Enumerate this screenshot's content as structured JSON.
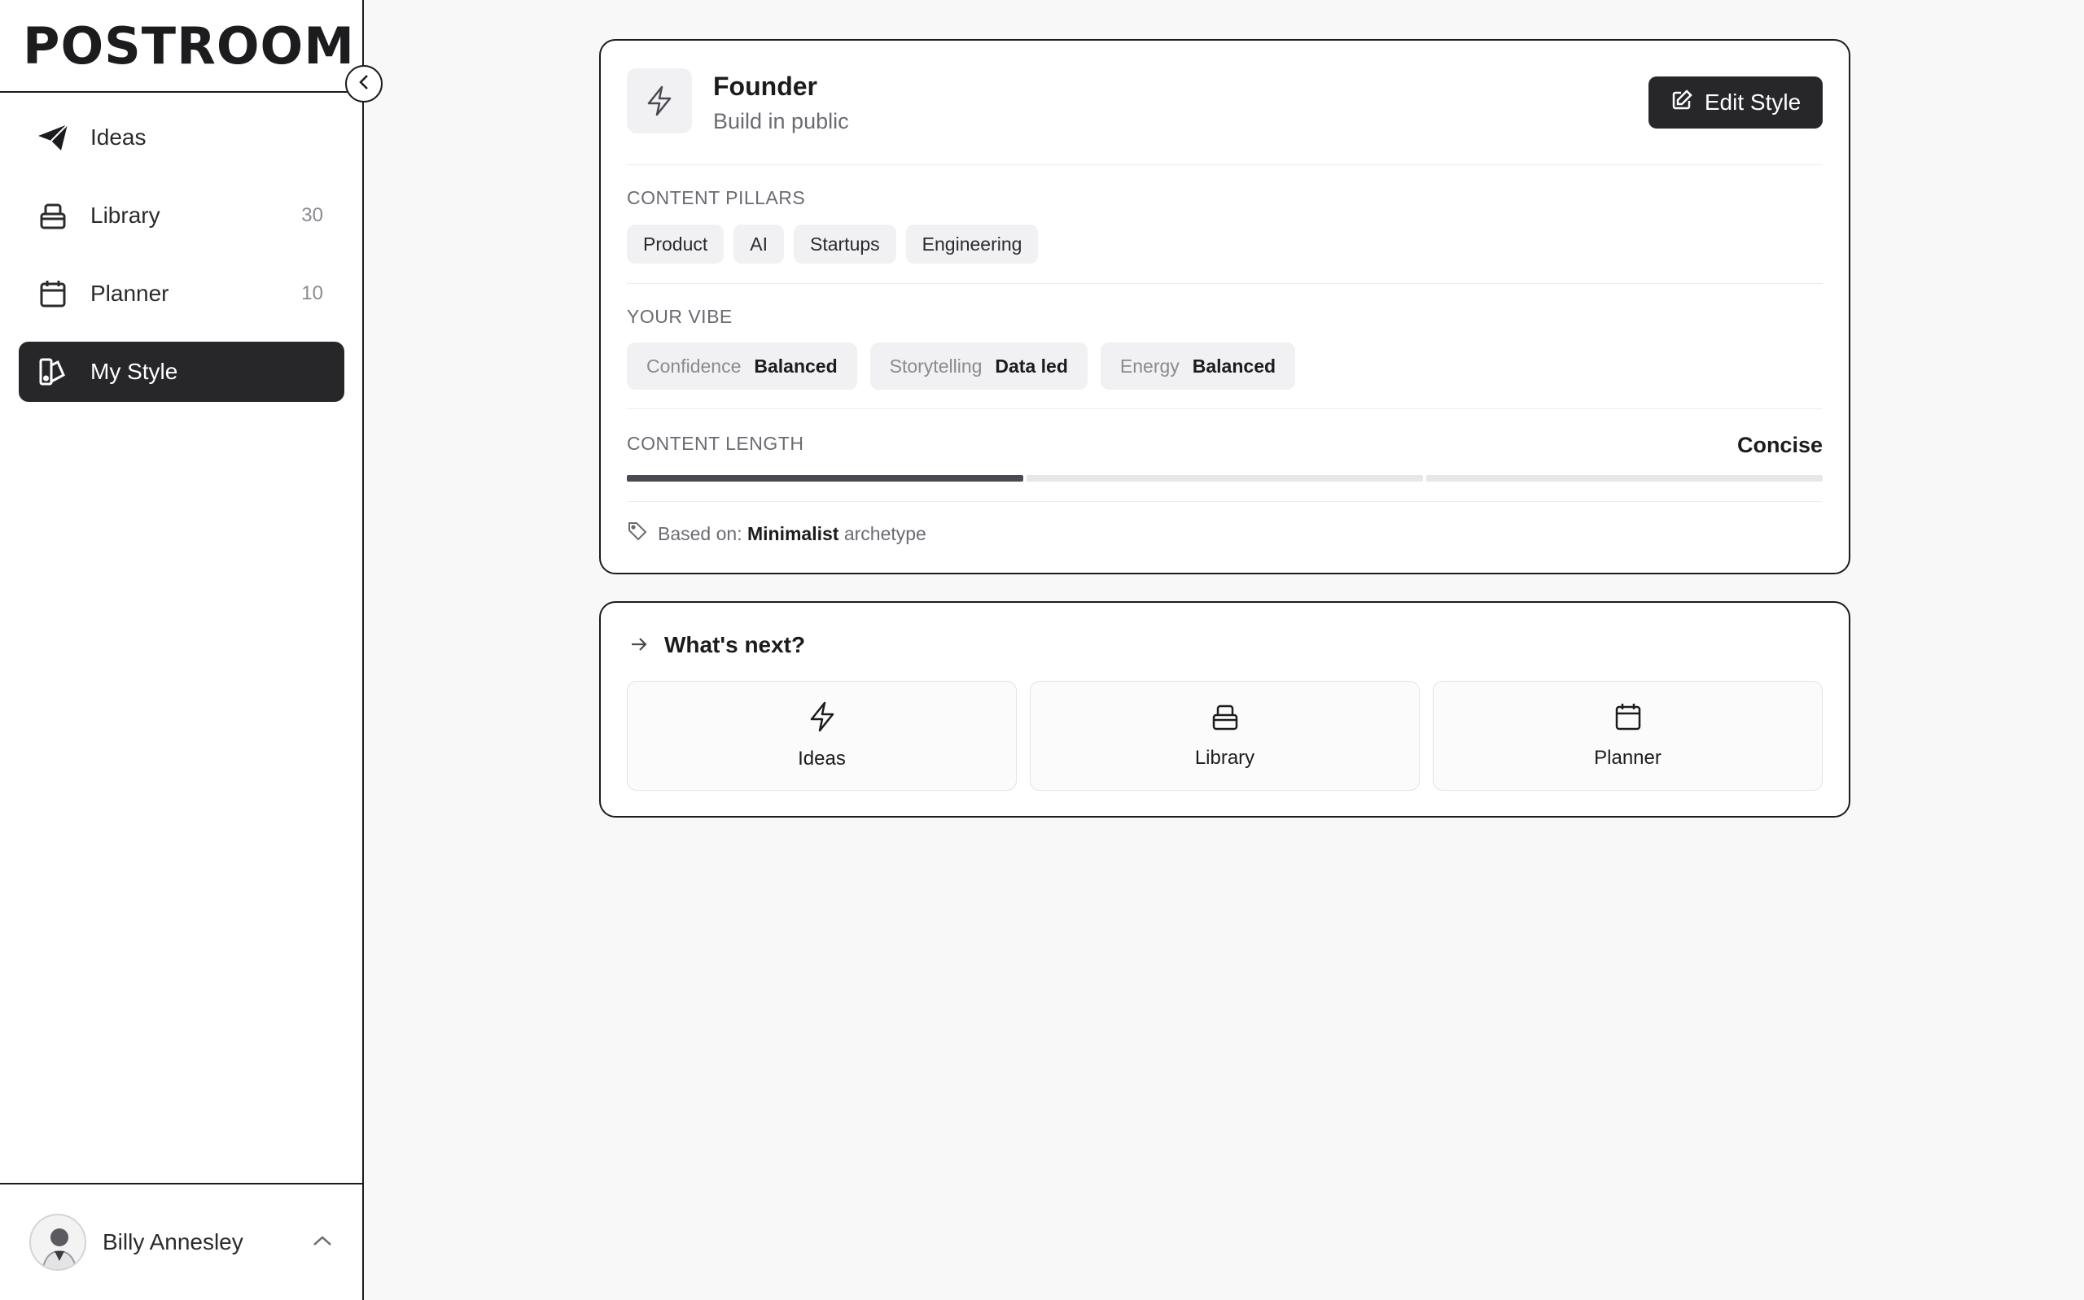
{
  "app": {
    "logo": "POSTROOM"
  },
  "sidebar": {
    "items": [
      {
        "label": "Ideas",
        "count": "",
        "icon": "paper-plane-icon"
      },
      {
        "label": "Library",
        "count": "30",
        "icon": "archive-icon"
      },
      {
        "label": "Planner",
        "count": "10",
        "icon": "calendar-icon"
      },
      {
        "label": "My Style",
        "count": "",
        "icon": "palette-icon",
        "active": true
      }
    ]
  },
  "user": {
    "name": "Billy Annesley"
  },
  "style_card": {
    "title": "Founder",
    "subtitle": "Build in public",
    "edit_label": "Edit Style",
    "pillars_label": "CONTENT PILLARS",
    "pillars": [
      "Product",
      "AI",
      "Startups",
      "Engineering"
    ],
    "vibe_label": "YOUR VIBE",
    "vibe": [
      {
        "key": "Confidence",
        "value": "Balanced"
      },
      {
        "key": "Storytelling",
        "value": "Data led"
      },
      {
        "key": "Energy",
        "value": "Balanced"
      }
    ],
    "length_label": "CONTENT LENGTH",
    "length_value": "Concise",
    "length_level": {
      "filled": 1,
      "total": 3
    },
    "based_prefix": "Based on:",
    "based_name": "Minimalist",
    "based_suffix": "archetype"
  },
  "next_card": {
    "title": "What's next?",
    "tiles": [
      {
        "label": "Ideas",
        "icon": "bolt-icon"
      },
      {
        "label": "Library",
        "icon": "archive-icon"
      },
      {
        "label": "Planner",
        "icon": "calendar-icon"
      }
    ]
  },
  "colors": {
    "dark": "#27272a",
    "background": "#f8f8f9",
    "chip": "#f1f1f3"
  }
}
